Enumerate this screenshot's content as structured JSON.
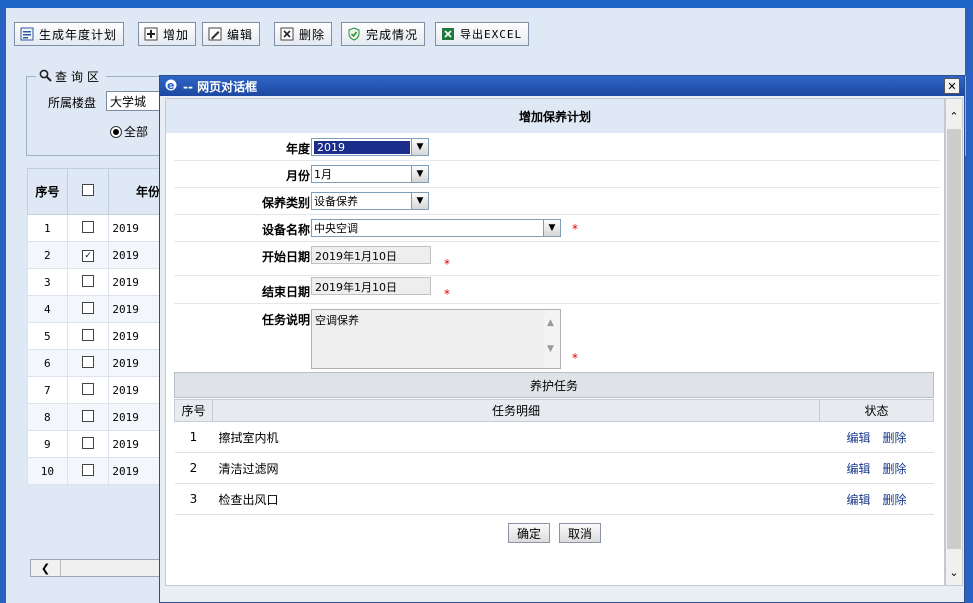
{
  "toolbar": {
    "buttons": [
      {
        "label": "生成年度计划",
        "icon": "plan-icon"
      },
      {
        "label": "增加",
        "icon": "add-icon"
      },
      {
        "label": "编辑",
        "icon": "edit-icon"
      },
      {
        "label": "删除",
        "icon": "delete-icon"
      },
      {
        "label": "完成情况",
        "icon": "check-icon"
      },
      {
        "label": "导出EXCEL",
        "icon": "excel-icon"
      }
    ]
  },
  "query": {
    "legend": "查询区",
    "building_label": "所属楼盘",
    "building_value": "大学城",
    "radio_all": "全部"
  },
  "list": {
    "headers": {
      "index": "序号",
      "year": "年份"
    },
    "rows": [
      {
        "index": "1",
        "checked": false,
        "year": "2019"
      },
      {
        "index": "2",
        "checked": true,
        "year": "2019"
      },
      {
        "index": "3",
        "checked": false,
        "year": "2019"
      },
      {
        "index": "4",
        "checked": false,
        "year": "2019"
      },
      {
        "index": "5",
        "checked": false,
        "year": "2019"
      },
      {
        "index": "6",
        "checked": false,
        "year": "2019"
      },
      {
        "index": "7",
        "checked": false,
        "year": "2019"
      },
      {
        "index": "8",
        "checked": false,
        "year": "2019"
      },
      {
        "index": "9",
        "checked": false,
        "year": "2019"
      },
      {
        "index": "10",
        "checked": false,
        "year": "2019"
      }
    ]
  },
  "dialog": {
    "title": "-- 网页对话框",
    "form_title": "增加保养计划",
    "fields": {
      "year": {
        "label": "年度",
        "value": "2019"
      },
      "month": {
        "label": "月份",
        "value": "1月"
      },
      "category": {
        "label": "保养类别",
        "value": "设备保养"
      },
      "device": {
        "label": "设备名称",
        "value": "中央空调"
      },
      "start_date": {
        "label": "开始日期",
        "value": "2019年1月10日"
      },
      "end_date": {
        "label": "结束日期",
        "value": "2019年1月10日"
      },
      "description": {
        "label": "任务说明",
        "value": "空调保养"
      }
    },
    "required_mark": "*",
    "task_section": "养护任务",
    "task_headers": {
      "index": "序号",
      "detail": "任务明细",
      "status": "状态"
    },
    "tasks": [
      {
        "index": "1",
        "detail": "擦拭室内机",
        "edit": "编辑",
        "delete": "删除"
      },
      {
        "index": "2",
        "detail": "清洁过滤网",
        "edit": "编辑",
        "delete": "删除"
      },
      {
        "index": "3",
        "detail": "检查出风口",
        "edit": "编辑",
        "delete": "删除"
      }
    ],
    "confirm_label": "确定",
    "cancel_label": "取消"
  }
}
